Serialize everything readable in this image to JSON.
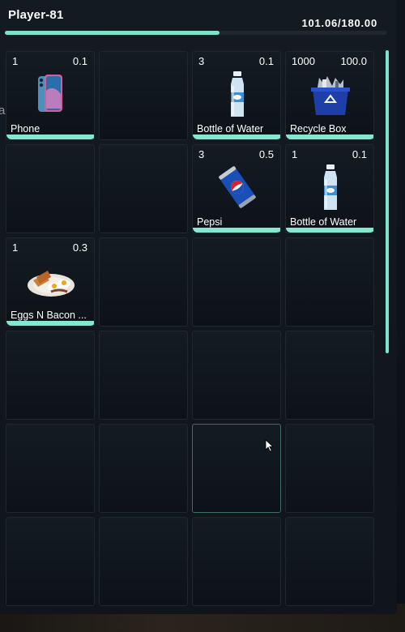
{
  "player": {
    "name": "Player-81"
  },
  "weight": {
    "label": "101.06/180.00",
    "current": 101.06,
    "max": 180.0
  },
  "side_hint": "ай",
  "colors": {
    "accent": "#7de2cb",
    "panel": "#12171e",
    "slot_border": "#1f272f"
  },
  "slots": [
    {
      "count": "1",
      "weight": "0.1",
      "label": "Phone",
      "icon": "phone-icon"
    },
    null,
    {
      "count": "3",
      "weight": "0.1",
      "label": "Bottle of Water",
      "icon": "water-bottle-icon"
    },
    {
      "count": "1000",
      "weight": "100.0",
      "label": "Recycle Box",
      "icon": "recycle-box-icon"
    },
    null,
    null,
    {
      "count": "3",
      "weight": "0.5",
      "label": "Pepsi",
      "icon": "pepsi-can-icon"
    },
    {
      "count": "1",
      "weight": "0.1",
      "label": "Bottle of Water",
      "icon": "water-bottle-icon"
    },
    {
      "count": "1",
      "weight": "0.3",
      "label": "Eggs N Bacon ...",
      "icon": "eggs-bacon-icon"
    },
    null,
    null,
    null,
    null,
    null,
    null,
    null,
    null,
    null,
    null,
    null,
    null,
    null,
    null,
    null
  ]
}
